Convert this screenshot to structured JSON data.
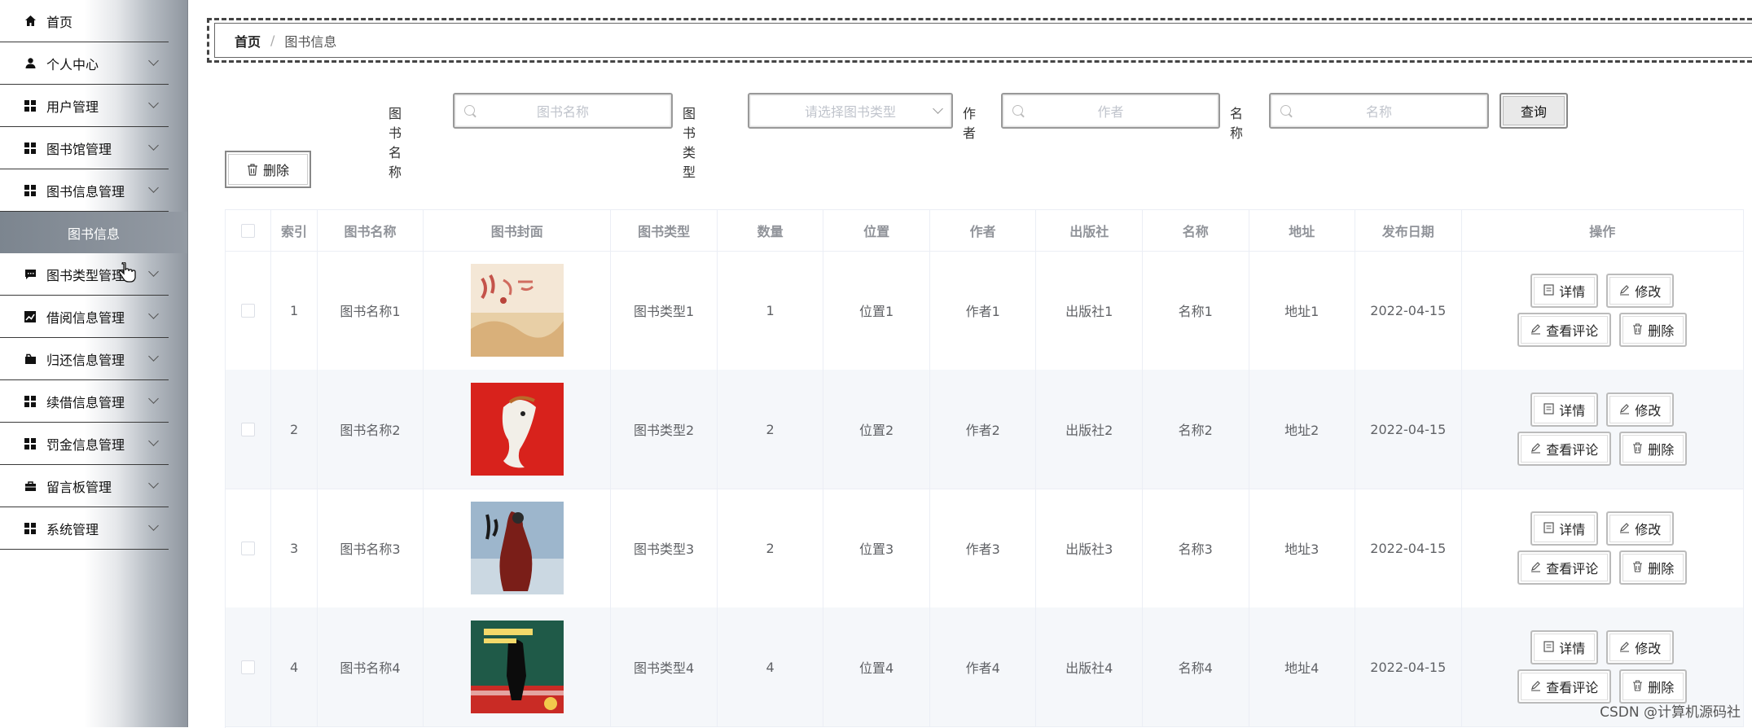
{
  "sidebar": {
    "items": [
      {
        "label": "首页",
        "icon": "home-icon",
        "has_arrow": false
      },
      {
        "label": "个人中心",
        "icon": "user-icon",
        "has_arrow": true
      },
      {
        "label": "用户管理",
        "icon": "grid-icon",
        "has_arrow": true
      },
      {
        "label": "图书馆管理",
        "icon": "grid-icon",
        "has_arrow": true
      },
      {
        "label": "图书信息管理",
        "icon": "grid-icon",
        "has_arrow": true
      },
      {
        "label": "图书类型管理",
        "icon": "message-icon",
        "has_arrow": true
      },
      {
        "label": "借阅信息管理",
        "icon": "chart-icon",
        "has_arrow": true
      },
      {
        "label": "归还信息管理",
        "icon": "folder-icon",
        "has_arrow": true
      },
      {
        "label": "续借信息管理",
        "icon": "grid-icon",
        "has_arrow": true
      },
      {
        "label": "罚金信息管理",
        "icon": "grid-icon",
        "has_arrow": true
      },
      {
        "label": "留言板管理",
        "icon": "briefcase-icon",
        "has_arrow": true
      },
      {
        "label": "系统管理",
        "icon": "grid-icon",
        "has_arrow": true
      }
    ],
    "active_submenu": "图书信息"
  },
  "breadcrumb": {
    "home": "首页",
    "separator": "/",
    "current": "图书信息"
  },
  "search": {
    "book_name_label": "图书名称",
    "book_name_placeholder": "图书名称",
    "book_type_label": "图书类型",
    "book_type_placeholder": "请选择图书类型",
    "author_label": "作者",
    "author_placeholder": "作者",
    "name_label": "名称",
    "name_placeholder": "名称",
    "query_button": "查询"
  },
  "toolbar": {
    "delete_label": "删除"
  },
  "table": {
    "headers": [
      "索引",
      "图书名称",
      "图书封面",
      "图书类型",
      "数量",
      "位置",
      "作者",
      "出版社",
      "名称",
      "地址",
      "发布日期",
      "操作"
    ],
    "rows": [
      {
        "index": "1",
        "book_name": "图书名称1",
        "book_type": "图书类型1",
        "quantity": "1",
        "location": "位置1",
        "author": "作者1",
        "publisher": "出版社1",
        "name": "名称1",
        "address": "地址1",
        "date": "2022-04-15",
        "cover": "cover-1"
      },
      {
        "index": "2",
        "book_name": "图书名称2",
        "book_type": "图书类型2",
        "quantity": "2",
        "location": "位置2",
        "author": "作者2",
        "publisher": "出版社2",
        "name": "名称2",
        "address": "地址2",
        "date": "2022-04-15",
        "cover": "cover-2"
      },
      {
        "index": "3",
        "book_name": "图书名称3",
        "book_type": "图书类型3",
        "quantity": "2",
        "location": "位置3",
        "author": "作者3",
        "publisher": "出版社3",
        "name": "名称3",
        "address": "地址3",
        "date": "2022-04-15",
        "cover": "cover-3"
      },
      {
        "index": "4",
        "book_name": "图书名称4",
        "book_type": "图书类型4",
        "quantity": "4",
        "location": "位置4",
        "author": "作者4",
        "publisher": "出版社4",
        "name": "名称4",
        "address": "地址4",
        "date": "2022-04-15",
        "cover": "cover-4"
      }
    ],
    "actions": {
      "detail": "详情",
      "edit": "修改",
      "view_comments": "查看评论",
      "delete": "删除"
    }
  },
  "watermark": "CSDN @计算机源码社",
  "colors": {
    "sidebar_active": "#8a929b",
    "table_stripe": "#f5f7fa",
    "placeholder": "#c0c4cc"
  }
}
